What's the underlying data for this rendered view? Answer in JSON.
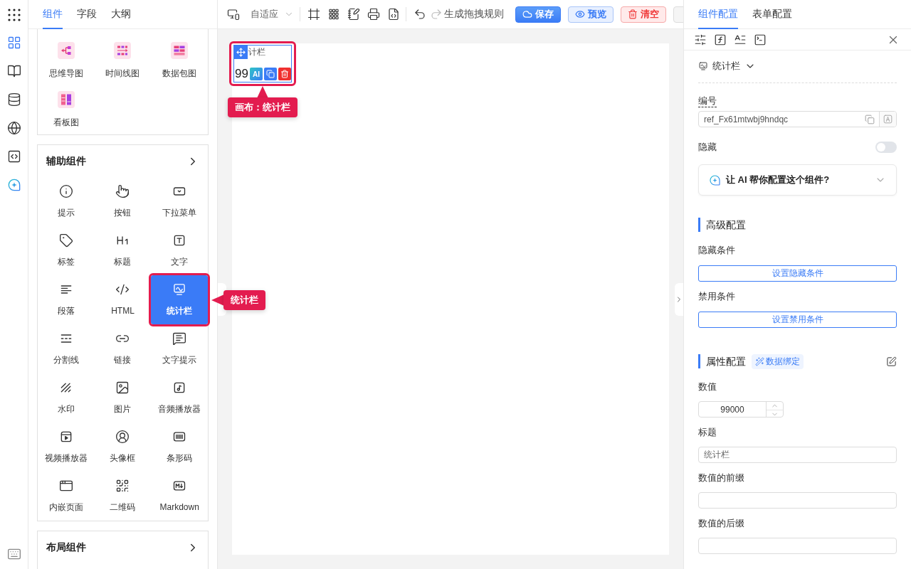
{
  "rail": {
    "items": [
      {
        "kind": "components",
        "selected": true
      },
      {
        "kind": "docs",
        "selected": false
      },
      {
        "kind": "database",
        "selected": false
      },
      {
        "kind": "globe",
        "selected": false
      },
      {
        "kind": "code",
        "selected": false
      },
      {
        "kind": "ai",
        "selected": false
      }
    ]
  },
  "left_panel": {
    "tabs": [
      {
        "label": "组件",
        "selected": true
      },
      {
        "label": "字段",
        "selected": false
      },
      {
        "label": "大纲",
        "selected": false
      }
    ],
    "groups": [
      {
        "items": [
          {
            "label": "思维导图",
            "kind": "mindmap",
            "selected": false
          },
          {
            "label": "时间线图",
            "kind": "timeline",
            "selected": false
          },
          {
            "label": "数据包图",
            "kind": "packet",
            "selected": false
          },
          {
            "label": "看板图",
            "kind": "kanban",
            "selected": false
          }
        ]
      },
      {
        "title": "辅助组件",
        "items": [
          {
            "label": "提示",
            "kind": "tip",
            "selected": false
          },
          {
            "label": "按钮",
            "kind": "button",
            "selected": false
          },
          {
            "label": "下拉菜单",
            "kind": "dropdown",
            "selected": false
          },
          {
            "label": "标签",
            "kind": "tag",
            "selected": false
          },
          {
            "label": "标题",
            "kind": "heading",
            "selected": false
          },
          {
            "label": "文字",
            "kind": "text",
            "selected": false
          },
          {
            "label": "段落",
            "kind": "paragraph",
            "selected": false
          },
          {
            "label": "HTML",
            "kind": "html",
            "selected": false
          },
          {
            "label": "统计栏",
            "kind": "stat",
            "selected": true
          },
          {
            "label": "分割线",
            "kind": "divider",
            "selected": false
          },
          {
            "label": "链接",
            "kind": "link",
            "selected": false
          },
          {
            "label": "文字提示",
            "kind": "tooltip",
            "selected": false
          },
          {
            "label": "水印",
            "kind": "watermark",
            "selected": false
          },
          {
            "label": "图片",
            "kind": "image",
            "selected": false
          },
          {
            "label": "音频播放器",
            "kind": "audio",
            "selected": false
          },
          {
            "label": "视频播放器",
            "kind": "video",
            "selected": false
          },
          {
            "label": "头像框",
            "kind": "avatar",
            "selected": false
          },
          {
            "label": "条形码",
            "kind": "barcode",
            "selected": false
          },
          {
            "label": "内嵌页面",
            "kind": "iframe",
            "selected": false
          },
          {
            "label": "二维码",
            "kind": "qrcode",
            "selected": false
          },
          {
            "label": "Markdown",
            "kind": "markdown",
            "selected": false
          }
        ]
      },
      {
        "title": "布局组件"
      }
    ],
    "selection_callout": "统计栏"
  },
  "toolbar": {
    "device_mode": "自适应",
    "tools": [
      {
        "kind": "frame"
      },
      {
        "kind": "grid"
      },
      {
        "kind": "edit"
      },
      {
        "kind": "print"
      },
      {
        "kind": "code"
      }
    ],
    "history": [
      {
        "kind": "undo",
        "disabled": false
      },
      {
        "kind": "redo",
        "disabled": true
      }
    ],
    "rule_button": "生成拖拽规则",
    "buttons": [
      {
        "kind": "save",
        "label": "保存"
      },
      {
        "kind": "preview",
        "label": "预览"
      },
      {
        "kind": "clear",
        "label": "清空"
      },
      {
        "kind": "more"
      }
    ]
  },
  "canvas": {
    "widget": {
      "title": "计栏",
      "value": "99",
      "selected": true,
      "actions": [
        {
          "kind": "ai",
          "label": "AI"
        },
        {
          "kind": "copy"
        },
        {
          "kind": "delete"
        }
      ],
      "callout": "画布：统计栏"
    }
  },
  "right_panel": {
    "tabs": [
      {
        "label": "组件配置",
        "selected": true
      },
      {
        "label": "表单配置",
        "selected": false
      }
    ],
    "tools": [
      {
        "kind": "style"
      },
      {
        "kind": "formula"
      },
      {
        "kind": "text"
      },
      {
        "kind": "script"
      }
    ],
    "component_type": "统计栏",
    "id_field": {
      "label": "编号",
      "value": "ref_Fx61mtwbj9hndqc"
    },
    "hidden": {
      "label": "隐藏",
      "on": false
    },
    "ai_assist": {
      "text": "让 AI 帮你配置这个组件?",
      "expanded": false
    },
    "sections": [
      {
        "title": "高级配置",
        "rows": [
          {
            "kind": "button",
            "label": "隐藏条件",
            "button": "设置隐藏条件"
          },
          {
            "kind": "button",
            "label": "禁用条件",
            "button": "设置禁用条件"
          }
        ]
      },
      {
        "title": "属性配置",
        "tag": "数据绑定",
        "rows": [
          {
            "kind": "number",
            "label": "数值",
            "value": "99000"
          },
          {
            "kind": "text",
            "label": "标题",
            "value": "统计栏"
          },
          {
            "kind": "text",
            "label": "数值的前缀"
          },
          {
            "kind": "text",
            "label": "数值的后缀"
          }
        ]
      }
    ]
  }
}
